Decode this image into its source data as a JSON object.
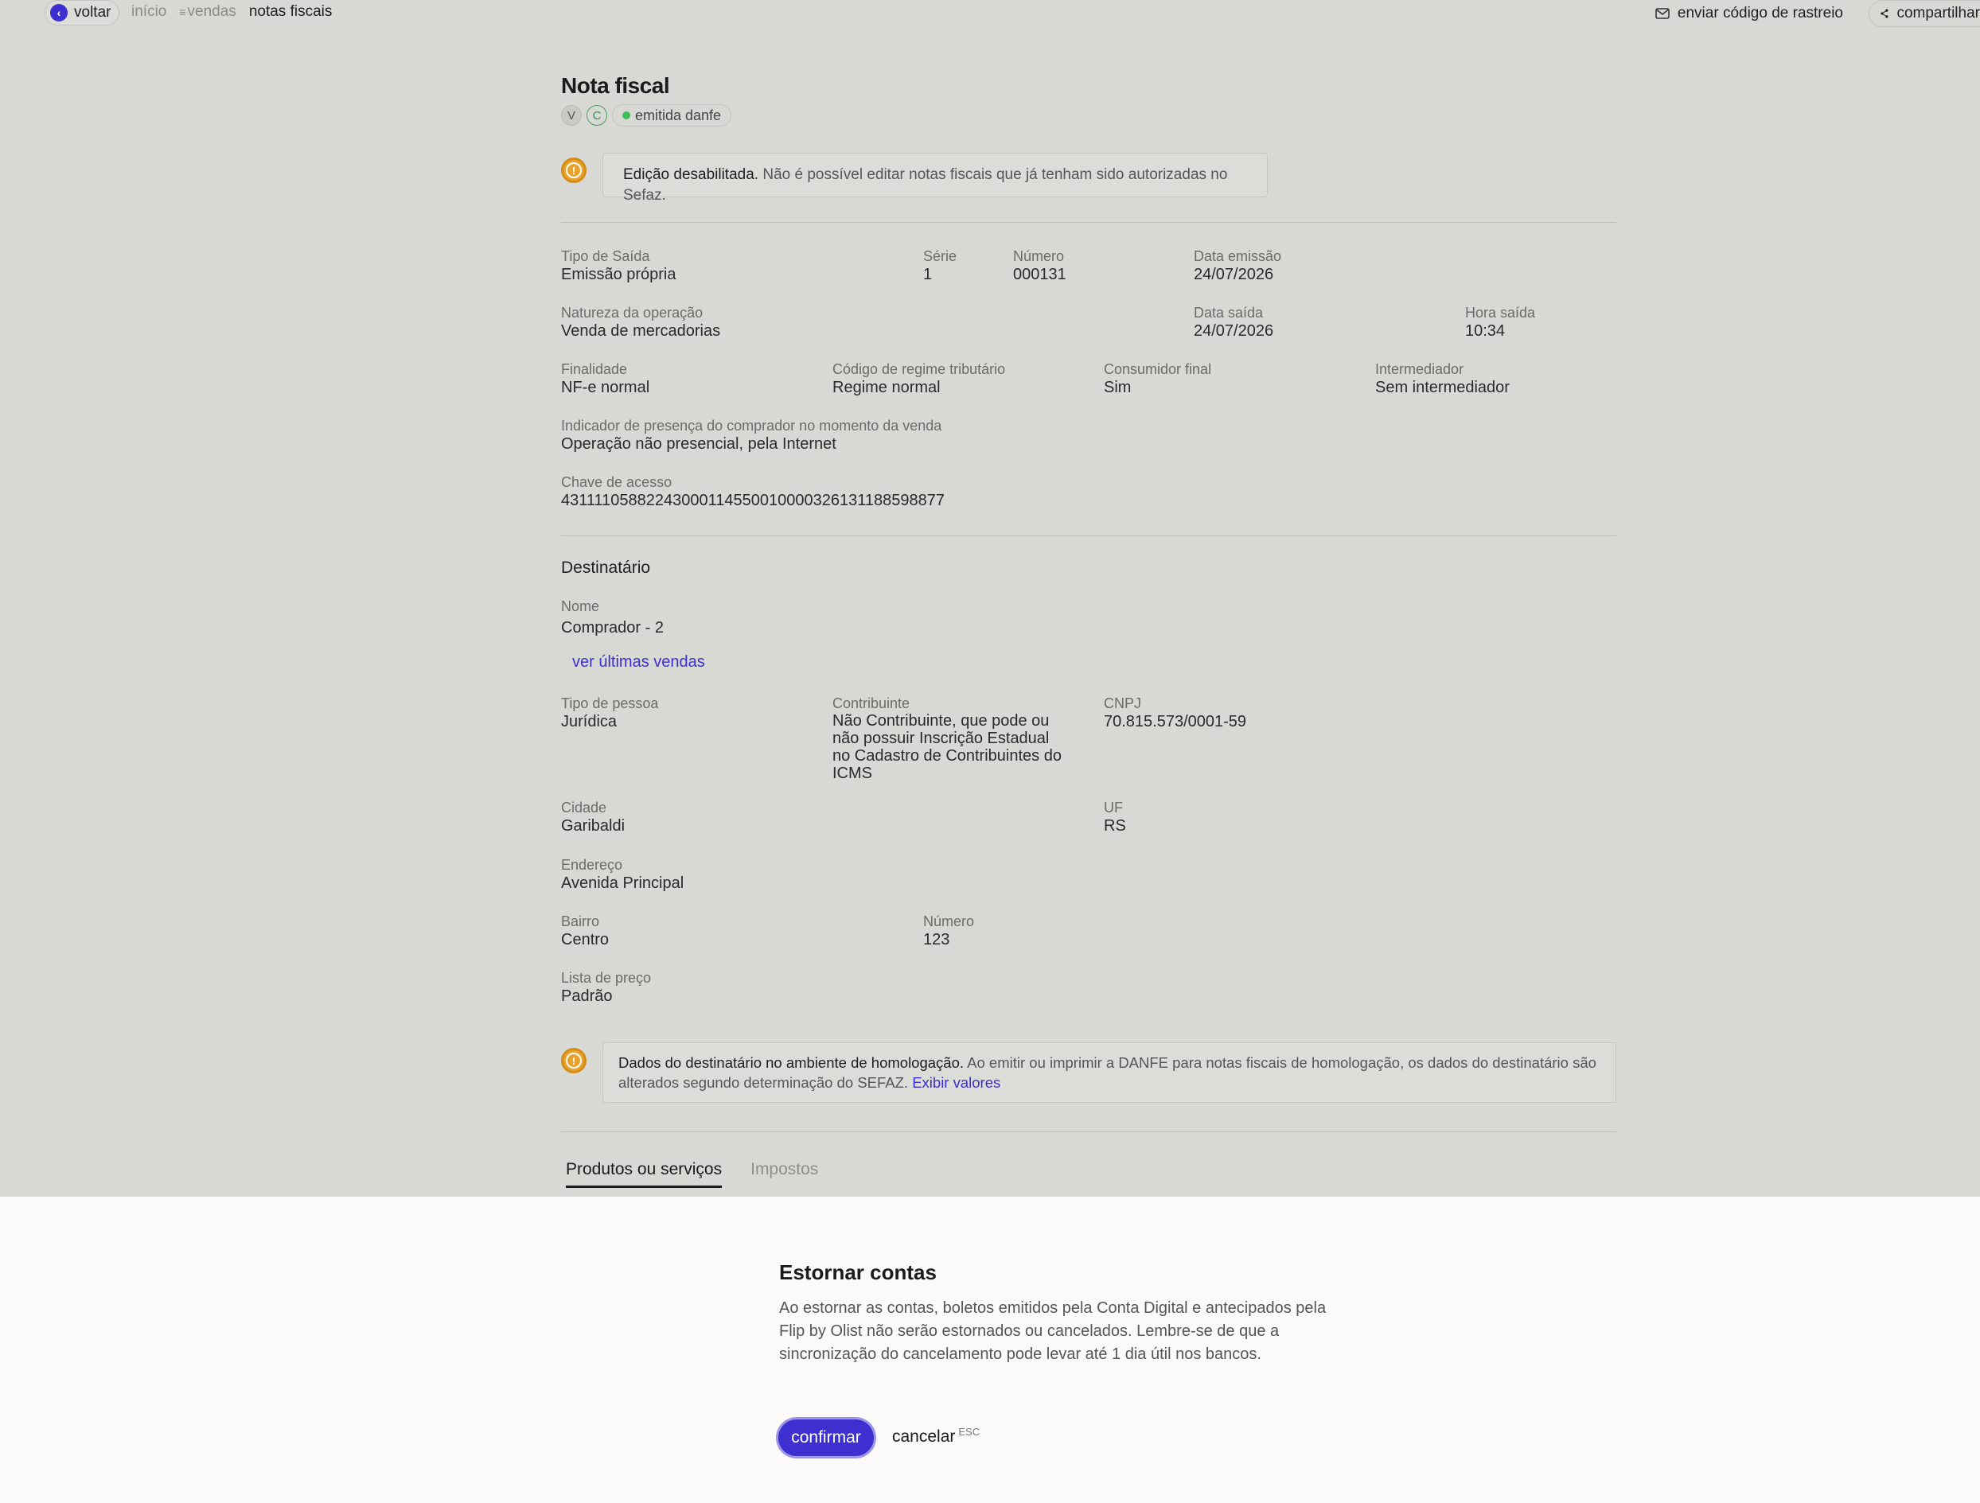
{
  "topbar": {
    "back_label": "voltar",
    "breadcrumbs": [
      "início",
      "vendas",
      "notas fiscais"
    ],
    "actions": {
      "tracking_label": "enviar código de rastreio",
      "share_label": "compartilhar"
    }
  },
  "page": {
    "title": "Nota fiscal",
    "badge_v": "V",
    "badge_c": "C",
    "status": "emitida danfe",
    "status_color": "#3fbf5a"
  },
  "alert_edit": {
    "bold": "Edição desabilitada.",
    "text": " Não é possível editar notas fiscais que já tenham sido autorizadas no Sefaz."
  },
  "fields": {
    "tipo_saida": {
      "label": "Tipo de Saída",
      "value": "Emissão própria"
    },
    "serie": {
      "label": "Série",
      "value": "1"
    },
    "numero": {
      "label": "Número",
      "value": "000131"
    },
    "data_emissao": {
      "label": "Data emissão",
      "value": "24/07/2026"
    },
    "natureza": {
      "label": "Natureza da operação",
      "value": "Venda de mercadorias"
    },
    "data_saida": {
      "label": "Data saída",
      "value": "24/07/2026"
    },
    "hora_saida": {
      "label": "Hora saída",
      "value": "10:34"
    },
    "finalidade": {
      "label": "Finalidade",
      "value": "NF-e normal"
    },
    "regime": {
      "label": "Código de regime tributário",
      "value": "Regime normal"
    },
    "consumidor": {
      "label": "Consumidor final",
      "value": "Sim"
    },
    "intermediador": {
      "label": "Intermediador",
      "value": "Sem intermediador"
    },
    "presenca": {
      "label": "Indicador de presença do comprador no momento da venda",
      "value": "Operação não presencial, pela Internet"
    },
    "chave": {
      "label": "Chave de acesso",
      "value": "43111105882243000114550010000326131188598877"
    }
  },
  "destinatario": {
    "section_title": "Destinatário",
    "nome": {
      "label": "Nome",
      "value": "Comprador - 2"
    },
    "ver_vendas": "ver últimas vendas",
    "tipo_pessoa": {
      "label": "Tipo de pessoa",
      "value": "Jurídica"
    },
    "contribuinte": {
      "label": "Contribuinte",
      "value": "Não Contribuinte, que pode ou não possuir Inscrição Estadual no Cadastro de Contribuintes do ICMS"
    },
    "cnpj": {
      "label": "CNPJ",
      "value": "70.815.573/0001-59"
    },
    "cidade": {
      "label": "Cidade",
      "value": "Garibaldi"
    },
    "uf": {
      "label": "UF",
      "value": "RS"
    },
    "endereco": {
      "label": "Endereço",
      "value": "Avenida Principal"
    },
    "bairro": {
      "label": "Bairro",
      "value": "Centro"
    },
    "numero": {
      "label": "Número",
      "value": "123"
    },
    "lista_preco": {
      "label": "Lista de preço",
      "value": "Padrão"
    }
  },
  "alert_homolog": {
    "bold": "Dados do destinatário no ambiente de homologação.",
    "text": " Ao emitir ou imprimir a DANFE para notas fiscais de homologação, os dados do destinatário são alterados segundo determinação do SEFAZ. ",
    "link": "Exibir valores"
  },
  "tabs": [
    "Produtos ou serviços",
    "Impostos"
  ],
  "modal": {
    "title": "Estornar contas",
    "text": "Ao estornar as contas, boletos emitidos pela Conta Digital e antecipados pela Flip by Olist não serão estornados ou cancelados. Lembre-se de que a sincronização do cancelamento pode levar até 1 dia útil nos bancos.",
    "confirm_label": "confirmar",
    "cancel_label": "cancelar",
    "cancel_shortcut": "ESC",
    "accent_color": "#3d2fd0"
  }
}
